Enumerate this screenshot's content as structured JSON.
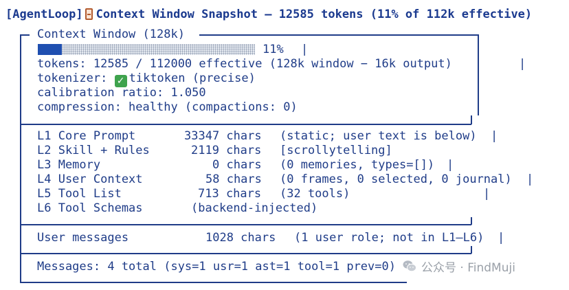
{
  "header": {
    "tag": "[AgentLoop]",
    "icon": "notebook-icon",
    "title": "Context Window Snapshot — 12585 tokens (11% of 112k effective)"
  },
  "panel": {
    "title": "Context Window (128k)",
    "usage_fraction": 0.11,
    "usage_label": "11%",
    "tokens_line": "tokens: 12585 / 112000 effective (128k window − 16k output)",
    "tokenizer_prefix": "tokenizer:",
    "tokenizer_status_icon": "check-icon",
    "tokenizer_value": "tiktoken (precise)",
    "calibration_line": "calibration ratio: 1.050",
    "compression_line": "compression: healthy (compactions: 0)"
  },
  "layers": [
    {
      "name": "L1 Core Prompt",
      "chars": "33347 chars",
      "note": "(static; user text is below)"
    },
    {
      "name": "L2 Skill + Rules",
      "chars": "2119 chars",
      "note": "[scrollytelling]"
    },
    {
      "name": "L3 Memory",
      "chars": "0 chars",
      "note": "(0 memories, types=[])"
    },
    {
      "name": "L4 User Context",
      "chars": "58 chars",
      "note": "(0 frames, 0 selected, 0 journal)"
    },
    {
      "name": "L5 Tool List",
      "chars": "713 chars",
      "note": "(32 tools)"
    },
    {
      "name": "L6 Tool Schemas",
      "chars": "",
      "note": "(backend-injected)"
    }
  ],
  "user_messages": {
    "name": "User messages",
    "chars": "1028 chars",
    "note": "(1 user role; not in L1–L6)"
  },
  "messages_line": "Messages: 4 total (sys=1 usr=1 ast=1 tool=1 prev=0)",
  "watermark": {
    "logo": "wechat-logo-icon",
    "text": "公众号 · FindMuji"
  },
  "colors": {
    "text": "#1f3c88",
    "bar_fill": "#1f4fb0",
    "check": "#3fa34d",
    "watermark": "#9aa0a8"
  }
}
